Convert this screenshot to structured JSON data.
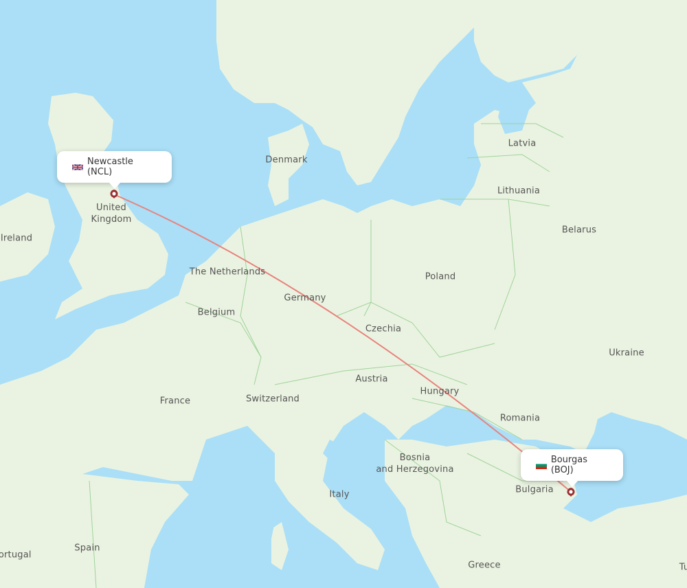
{
  "map": {
    "colors": {
      "water": "#aadff7",
      "land": "#eaf3e1",
      "border": "#9fd39a",
      "route": "#e8837e",
      "marker": "#9b2f33"
    },
    "route": {
      "origin": {
        "city": "Newcastle",
        "code": "NCL",
        "label": "Newcastle (NCL)",
        "flag": "uk-flag-icon"
      },
      "destination": {
        "city": "Bourgas",
        "code": "BOJ",
        "label": "Bourgas (BOJ)",
        "flag": "bulgaria-flag-icon"
      }
    },
    "country_labels": [
      {
        "id": "latvia",
        "text": "Latvia"
      },
      {
        "id": "denmark",
        "text": "Denmark"
      },
      {
        "id": "lithuania",
        "text": "Lithuania"
      },
      {
        "id": "united-kingdom",
        "text": "United\nKingdom"
      },
      {
        "id": "belarus",
        "text": "Belarus"
      },
      {
        "id": "ireland",
        "text": "Ireland"
      },
      {
        "id": "the-netherlands",
        "text": "The Netherlands"
      },
      {
        "id": "poland",
        "text": "Poland"
      },
      {
        "id": "germany",
        "text": "Germany"
      },
      {
        "id": "belgium",
        "text": "Belgium"
      },
      {
        "id": "czechia",
        "text": "Czechia"
      },
      {
        "id": "ukraine",
        "text": "Ukraine"
      },
      {
        "id": "austria",
        "text": "Austria"
      },
      {
        "id": "hungary",
        "text": "Hungary"
      },
      {
        "id": "switzerland",
        "text": "Switzerland"
      },
      {
        "id": "france",
        "text": "France"
      },
      {
        "id": "romania",
        "text": "Romania"
      },
      {
        "id": "bosnia",
        "text": "Bosnia\nand Herzegovina"
      },
      {
        "id": "bulgaria",
        "text": "Bulgaria"
      },
      {
        "id": "italy",
        "text": "Italy"
      },
      {
        "id": "spain",
        "text": "Spain"
      },
      {
        "id": "portugal",
        "text": "Portugal"
      },
      {
        "id": "greece",
        "text": "Greece"
      },
      {
        "id": "turkey-partial",
        "text": "Tu"
      }
    ]
  }
}
